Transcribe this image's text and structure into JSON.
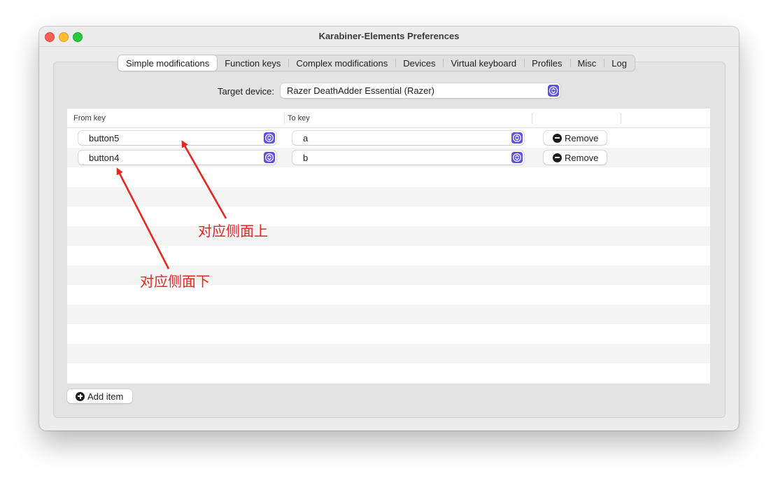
{
  "window": {
    "title": "Karabiner-Elements Preferences"
  },
  "tabs": [
    {
      "label": "Simple modifications",
      "active": true
    },
    {
      "label": "Function keys",
      "active": false
    },
    {
      "label": "Complex modifications",
      "active": false
    },
    {
      "label": "Devices",
      "active": false
    },
    {
      "label": "Virtual keyboard",
      "active": false
    },
    {
      "label": "Profiles",
      "active": false
    },
    {
      "label": "Misc",
      "active": false
    },
    {
      "label": "Log",
      "active": false
    }
  ],
  "target": {
    "label": "Target device:",
    "value": "Razer DeathAdder Essential (Razer)"
  },
  "table": {
    "headers": {
      "from": "From key",
      "to": "To key"
    },
    "rows": [
      {
        "from": "button5",
        "to": "a",
        "remove_label": "Remove"
      },
      {
        "from": "button4",
        "to": "b",
        "remove_label": "Remove"
      }
    ]
  },
  "add_item_label": "Add item",
  "annotations": {
    "top": "对应侧面上",
    "bottom": "对应侧面下",
    "color": "#e8261e"
  },
  "colors": {
    "accent": "#5a4cf0",
    "close": "#ff5f57",
    "minimize": "#febc2e",
    "maximize": "#28c840"
  }
}
